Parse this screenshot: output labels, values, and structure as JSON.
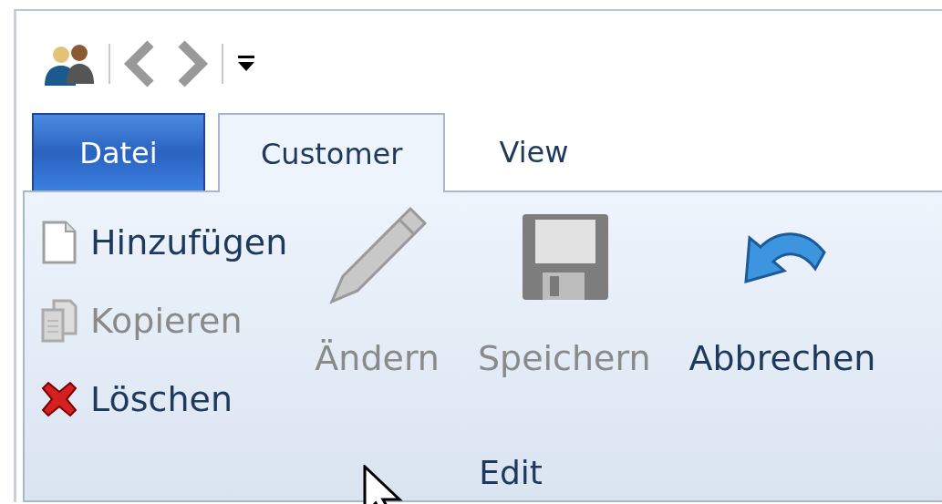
{
  "tabs": [
    {
      "label": "Datei",
      "kind": "file",
      "selected": false
    },
    {
      "label": "Customer",
      "kind": "tab",
      "selected": true
    },
    {
      "label": "View",
      "kind": "tab",
      "selected": false
    }
  ],
  "group": {
    "label": "Edit",
    "small_buttons": [
      {
        "label": "Hinzufügen",
        "kind": "add",
        "disabled": false
      },
      {
        "label": "Kopieren",
        "kind": "copy",
        "disabled": true
      },
      {
        "label": "Löschen",
        "kind": "delete",
        "disabled": false
      }
    ],
    "large_buttons": [
      {
        "label": "Ändern",
        "kind": "edit",
        "disabled": true
      },
      {
        "label": "Speichern",
        "kind": "save",
        "disabled": true
      },
      {
        "label": "Abbrechen",
        "kind": "cancel",
        "disabled": false
      }
    ]
  }
}
